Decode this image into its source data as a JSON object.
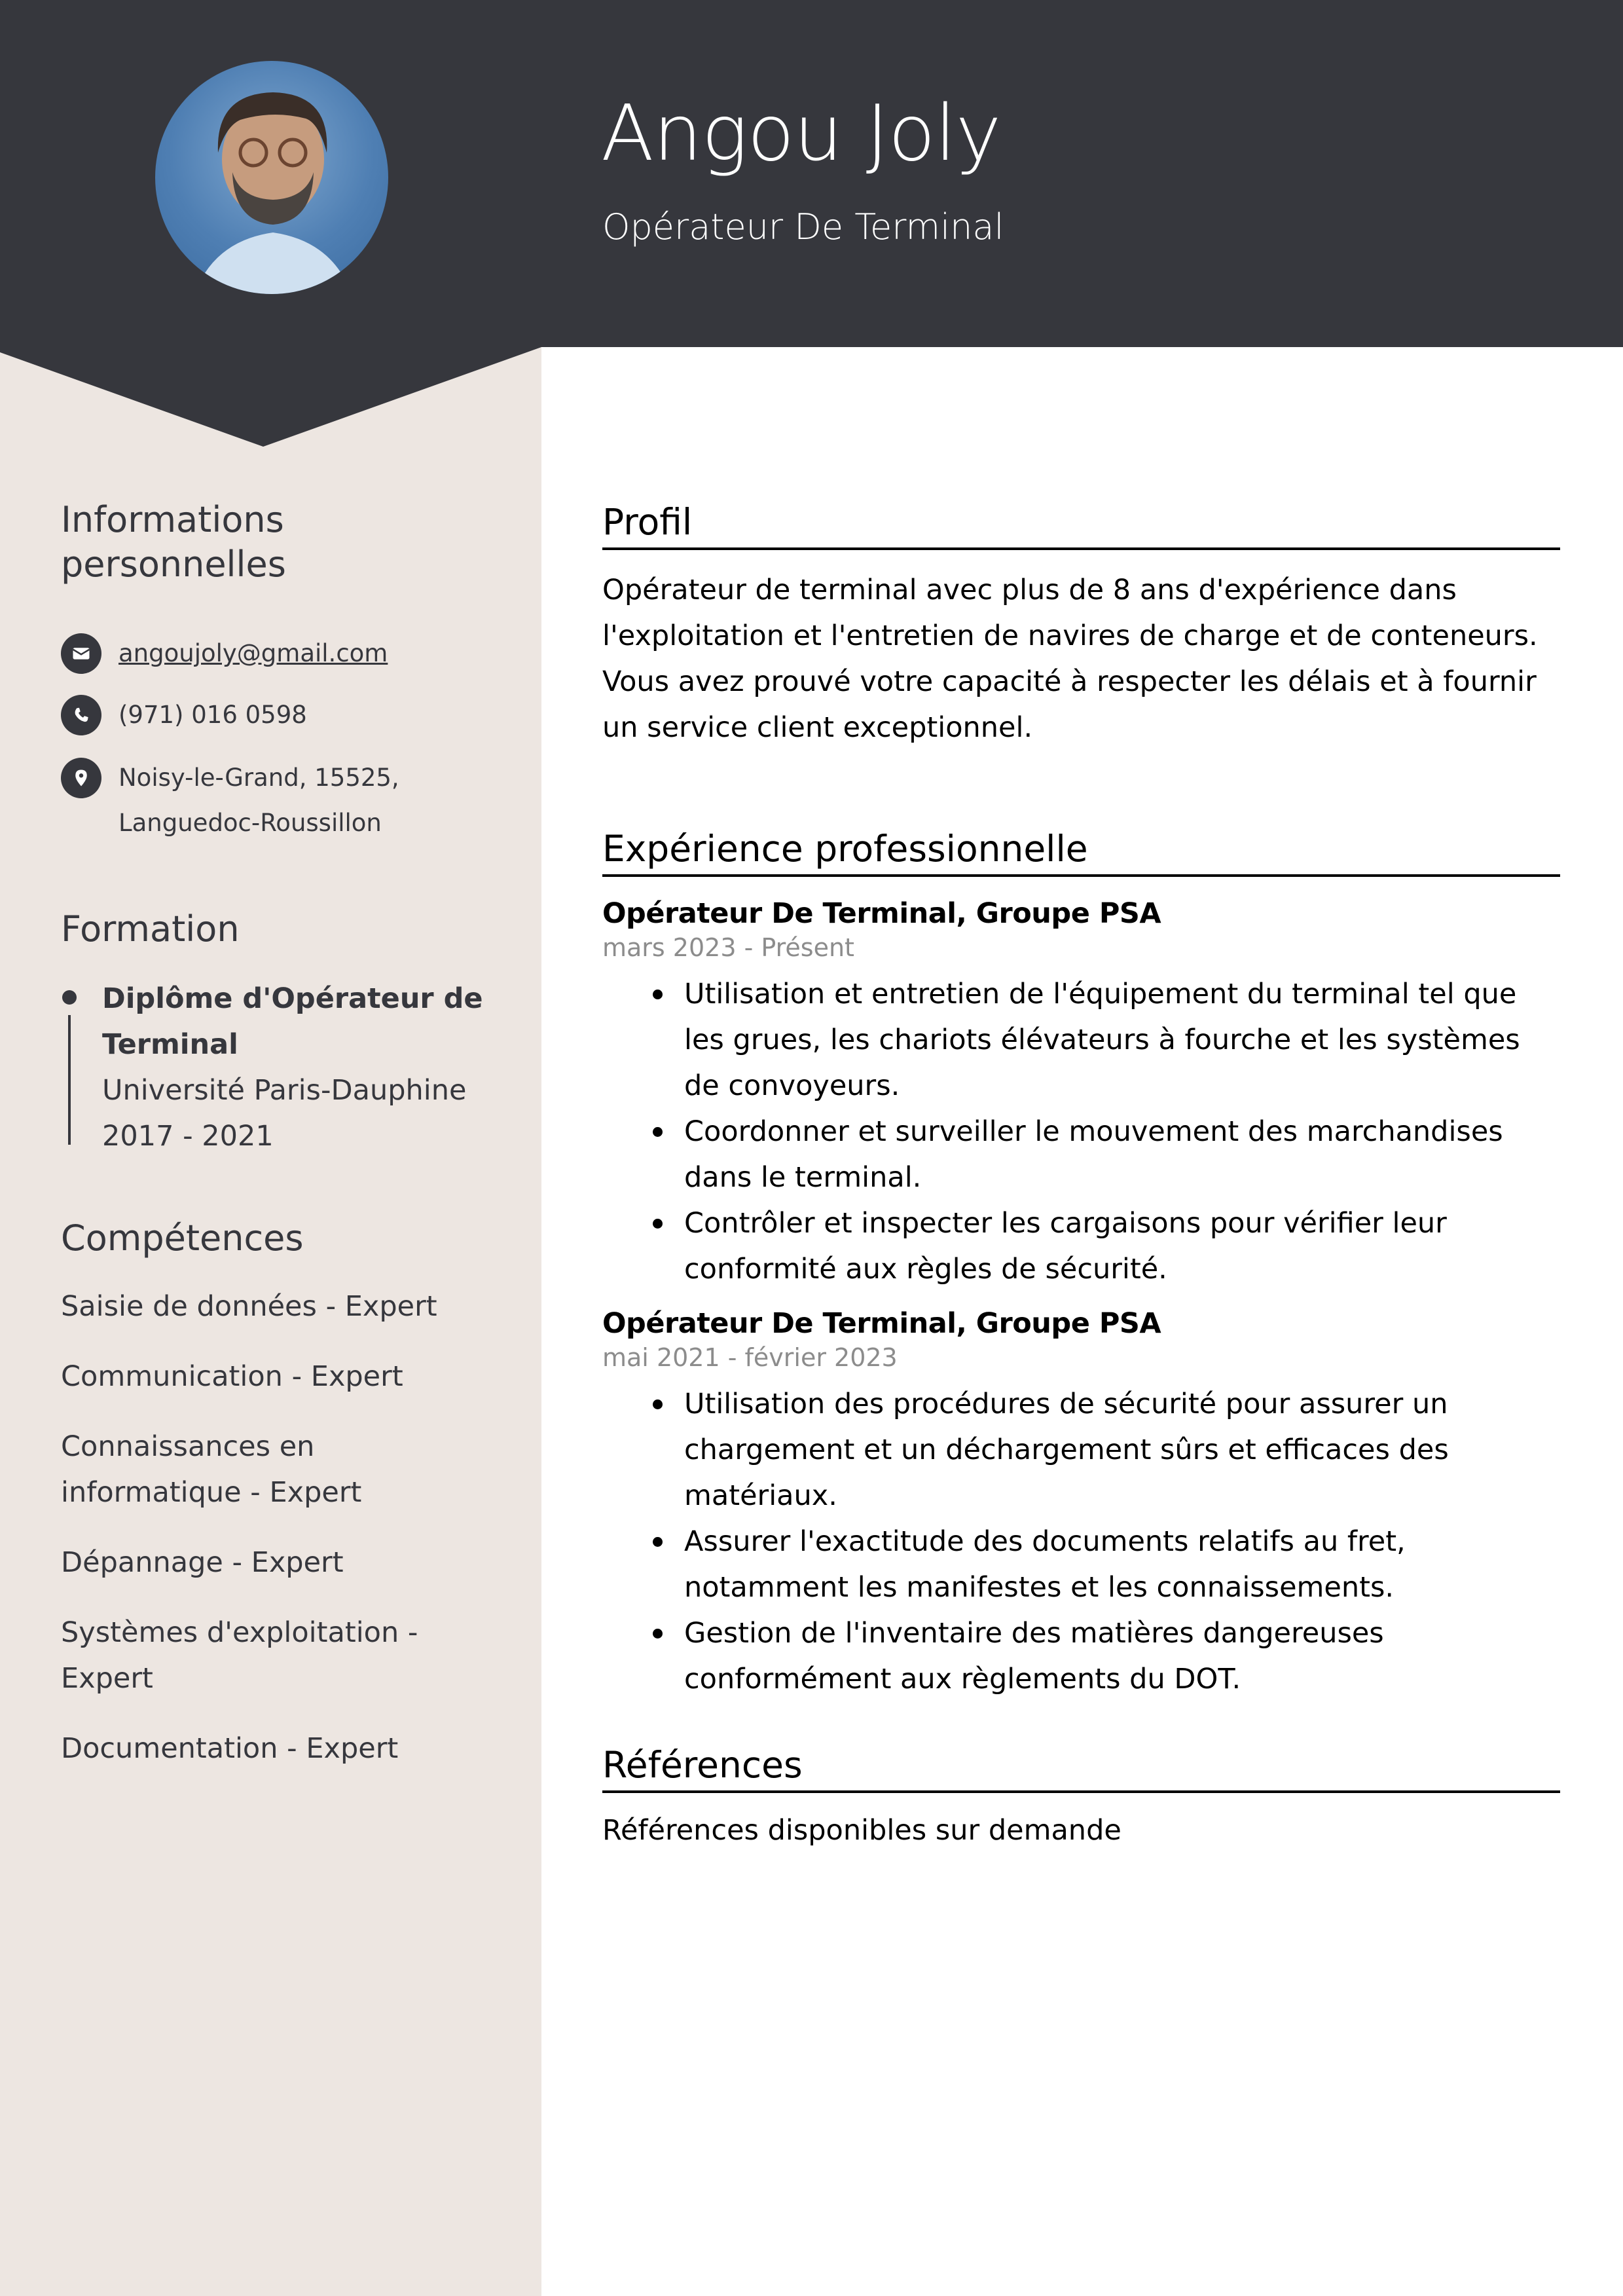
{
  "header": {
    "name": "Angou Joly",
    "job_title": "Opérateur De Terminal",
    "colors": {
      "header_bg": "#36373d",
      "sidebar_bg": "#ede6e1",
      "text_on_header": "#ffffff"
    }
  },
  "photo": {
    "alt": "Portrait photo"
  },
  "sidebar": {
    "personal_info": {
      "heading": "Informations personnelles",
      "email": {
        "icon": "envelope-icon",
        "value": "angoujoly@gmail.com"
      },
      "phone": {
        "icon": "phone-icon",
        "value": "(971) 016 0598"
      },
      "address": {
        "icon": "location-pin-icon",
        "line1": "Noisy-le-Grand, 15525,",
        "line2": "Languedoc-Roussillon"
      }
    },
    "education": {
      "heading": "Formation",
      "items": [
        {
          "degree": "Diplôme d'Opérateur de Terminal",
          "school": "Université Paris-Dauphine",
          "years": "2017 - 2021"
        }
      ]
    },
    "skills": {
      "heading": "Compétences",
      "items": [
        "Saisie de données - Expert",
        "Communication - Expert",
        "Connaissances en informatique - Expert",
        "Dépannage - Expert",
        "Systèmes d'exploitation - Expert",
        "Documentation - Expert"
      ]
    }
  },
  "main": {
    "profile": {
      "heading": "Profil",
      "text": "Opérateur de terminal avec plus de 8 ans d'expérience dans l'exploitation et l'entretien de navires de charge et de conteneurs. Vous avez prouvé votre capacité à respecter les délais et à fournir un service client exceptionnel."
    },
    "experience": {
      "heading": "Expérience professionnelle",
      "jobs": [
        {
          "title": "Opérateur De Terminal, Groupe PSA",
          "dates": "mars 2023 - Présent",
          "bullets": [
            "Utilisation et entretien de l'équipement du terminal tel que les grues, les chariots élévateurs à fourche et les systèmes de convoyeurs.",
            "Coordonner et surveiller le mouvement des marchandises dans le terminal.",
            "Contrôler et inspecter les cargaisons pour vérifier leur conformité aux règles de sécurité."
          ]
        },
        {
          "title": "Opérateur De Terminal, Groupe PSA",
          "dates": "mai 2021 - février 2023",
          "bullets": [
            "Utilisation des procédures de sécurité pour assurer un chargement et un déchargement sûrs et efficaces des matériaux.",
            "Assurer l'exactitude des documents relatifs au fret, notamment les manifestes et les connaissements.",
            "Gestion de l'inventaire des matières dangereuses conformément aux règlements du DOT."
          ]
        }
      ]
    },
    "references": {
      "heading": "Références",
      "text": "Références disponibles sur demande"
    }
  }
}
